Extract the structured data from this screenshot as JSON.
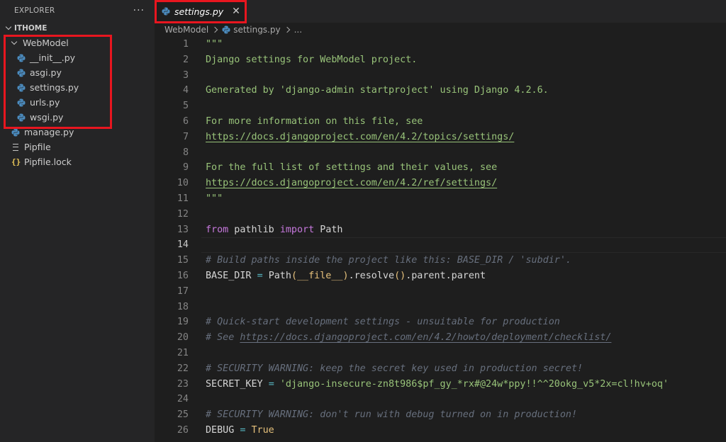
{
  "sidebar": {
    "title": "EXPLORER",
    "more": "···",
    "root": "ITHOME",
    "folder": "WebModel",
    "folder_files": [
      "__init__.py",
      "asgi.py",
      "settings.py",
      "urls.py",
      "wsgi.py"
    ],
    "root_files": [
      {
        "name": "manage.py",
        "icon": "python-icon"
      },
      {
        "name": "Pipfile",
        "icon": "file-lines-icon"
      },
      {
        "name": "Pipfile.lock",
        "icon": "json-braces-icon"
      }
    ]
  },
  "tab": {
    "title": "settings.py",
    "close": "✕"
  },
  "breadcrumb": {
    "folder": "WebModel",
    "file": "settings.py",
    "more": "..."
  },
  "editor": {
    "lines": [
      "\"\"\"",
      "Django settings for WebModel project.",
      "",
      "Generated by 'django-admin startproject' using Django 4.2.6.",
      "",
      "For more information on this file, see",
      "https://docs.djangoproject.com/en/4.2/topics/settings/",
      "",
      "For the full list of settings and their values, see",
      "https://docs.djangoproject.com/en/4.2/ref/settings/",
      "\"\"\"",
      "",
      "from pathlib import Path",
      "",
      "# Build paths inside the project like this: BASE_DIR / 'subdir'.",
      "BASE_DIR = Path(__file__).resolve().parent.parent",
      "",
      "",
      "# Quick-start development settings - unsuitable for production",
      "# See https://docs.djangoproject.com/en/4.2/howto/deployment/checklist/",
      "",
      "# SECURITY WARNING: keep the secret key used in production secret!",
      "SECRET_KEY = 'django-insecure-zn8t986$pf_gy_*rx#@24w*ppy!!^^20okg_v5*2x=cl!hv+oq'",
      "",
      "# SECURITY WARNING: don't run with debug turned on in production!",
      "DEBUG = True"
    ],
    "current_line": 14
  },
  "colors": {
    "highlight_box": "#e8161f",
    "string": "#98c379",
    "comment": "#676f7d",
    "keyword": "#c678dd",
    "editor_bg": "#1e1e1e",
    "sidebar_bg": "#252526"
  }
}
